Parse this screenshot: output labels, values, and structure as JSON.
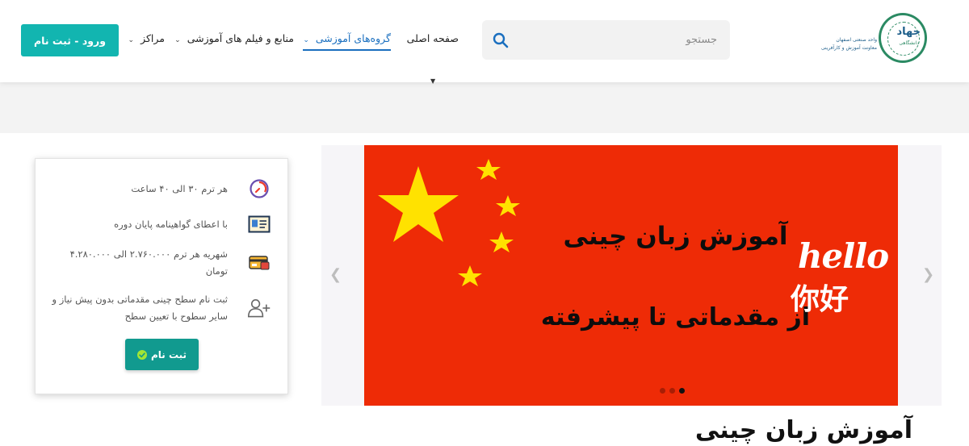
{
  "header": {
    "logo": {
      "name": "جهاد",
      "sub": "دانشگاهی",
      "tagline_1": "واحد صنعتی اصفهان",
      "tagline_2": "معاونت آموزش و کارآفرینی"
    },
    "search": {
      "placeholder": "جستجو",
      "icon": "search-icon"
    },
    "nav": {
      "home": "صفحه اصلی",
      "groups": "گروه‌های آموزشی",
      "resources": "منابع و فیلم های آموزشی",
      "centers": "مراکز"
    },
    "login_label": "ورود - ثبت نام",
    "accent_color": "#12b5b0"
  },
  "card": {
    "items": [
      {
        "icon": "clock-icon",
        "text": "هر ترم ۳۰ الی ۴۰ ساعت"
      },
      {
        "icon": "certificate-icon",
        "text": "با اعطای گواهینامه پایان دوره"
      },
      {
        "icon": "credit-card-icon",
        "text": "شهریه هر ترم ۲.۷۶۰.۰۰۰ الی ۴.۲۸۰.۰۰۰ تومان"
      },
      {
        "icon": "add-user-icon",
        "text": "ثبت نام سطح چینی مقدماتی بدون پیش نیاز و سایر سطوح با تعیین سطح"
      }
    ],
    "register_label": "ثبت نام",
    "register_color": "#119a8f"
  },
  "slider": {
    "title_line_1": "آموزش زبان چینی",
    "title_line_2": "از مقدماتی تا پیشرفته",
    "hello": "hello",
    "chinese": "你好",
    "background_color": "#ee2b06",
    "star_color": "#ffe200",
    "slide_count": 3,
    "active_slide": 3
  },
  "page_heading": "آموزش زبان چینی"
}
